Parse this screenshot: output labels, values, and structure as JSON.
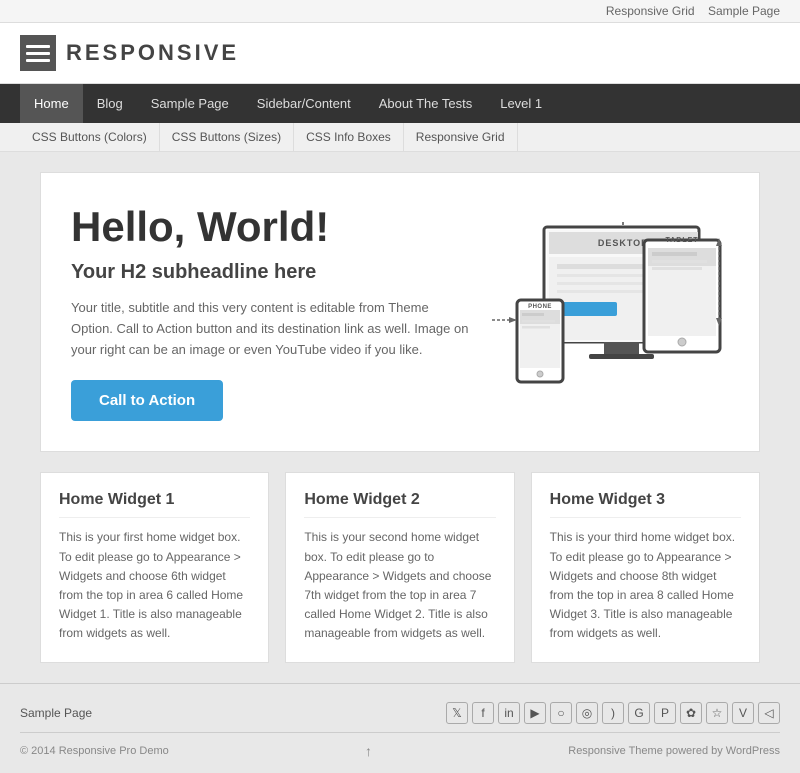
{
  "topbar": {
    "links": [
      "Responsive Grid",
      "Sample Page"
    ]
  },
  "header": {
    "logo_text": "RESPONSIVE"
  },
  "main_nav": {
    "items": [
      {
        "label": "Home",
        "active": true
      },
      {
        "label": "Blog"
      },
      {
        "label": "Sample Page"
      },
      {
        "label": "Sidebar/Content"
      },
      {
        "label": "About The Tests"
      },
      {
        "label": "Level 1"
      }
    ]
  },
  "sub_nav": {
    "items": [
      {
        "label": "CSS Buttons (Colors)"
      },
      {
        "label": "CSS Buttons (Sizes)"
      },
      {
        "label": "CSS Info Boxes"
      },
      {
        "label": "Responsive Grid"
      }
    ]
  },
  "hero": {
    "h1": "Hello, World!",
    "h2": "Your H2 subheadline here",
    "body": "Your title, subtitle and this very content is editable from Theme Option. Call to Action button and its destination link as well. Image on your right can be an image or even YouTube video if you like.",
    "cta_label": "Call to Action",
    "device_labels": {
      "desktop": "DESKTOP",
      "tablet": "TABLET",
      "phone": "PHONE"
    }
  },
  "widgets": [
    {
      "title": "Home Widget 1",
      "body": "This is your first home widget box. To edit please go to Appearance > Widgets and choose 6th widget from the top in area 6 called Home Widget 1. Title is also manageable from widgets as well."
    },
    {
      "title": "Home Widget 2",
      "body": "This is your second home widget box. To edit please go to Appearance > Widgets and choose 7th widget from the top in area 7 called Home Widget 2. Title is also manageable from widgets as well."
    },
    {
      "title": "Home Widget 3",
      "body": "This is your third home widget box. To edit please go to Appearance > Widgets and choose 8th widget from the top in area 8 called Home Widget 3. Title is also manageable from widgets as well."
    }
  ],
  "footer": {
    "sample_page": "Sample Page",
    "social_icons": [
      "𝕏",
      "f",
      "in",
      "▶",
      "○",
      "◎",
      "§",
      "G+",
      "◉",
      "✿",
      "☆",
      "v",
      "◁"
    ],
    "social_labels": [
      "twitter",
      "facebook",
      "linkedin",
      "youtube",
      "circle1",
      "instagram",
      "rss",
      "google-plus",
      "pinterest",
      "stumble",
      "bookmark",
      "vimeo",
      "back"
    ],
    "copyright": "© 2014 Responsive Pro Demo",
    "powered_by": "Responsive Theme powered by WordPress"
  }
}
